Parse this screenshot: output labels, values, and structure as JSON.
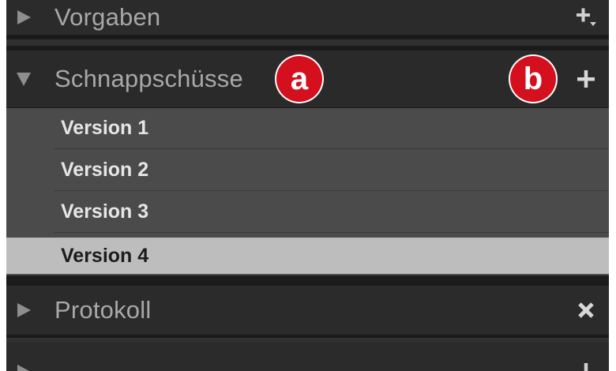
{
  "panels": {
    "presets": {
      "title": "Vorgaben",
      "action_icon": "add-with-dropdown-icon",
      "state": "collapsed"
    },
    "snapshots": {
      "title": "Schnappschüsse",
      "action_icon": "plus-icon",
      "state": "expanded",
      "items": [
        {
          "label": "Version 1",
          "selected": false
        },
        {
          "label": "Version 2",
          "selected": false
        },
        {
          "label": "Version 3",
          "selected": false
        },
        {
          "label": "Version 4",
          "selected": true
        }
      ]
    },
    "history": {
      "title": "Protokoll",
      "action_icon": "clear-x-icon",
      "state": "collapsed"
    },
    "next_panel": {
      "title": "",
      "state": "collapsed"
    }
  },
  "annotations": {
    "a": "a",
    "b": "b"
  },
  "colors": {
    "panel_bg": "#292929",
    "list_bg": "#4b4b4b",
    "selected_bg": "#bdbdbd",
    "badge_red": "#d4101e",
    "header_text": "#a8a8a8"
  }
}
